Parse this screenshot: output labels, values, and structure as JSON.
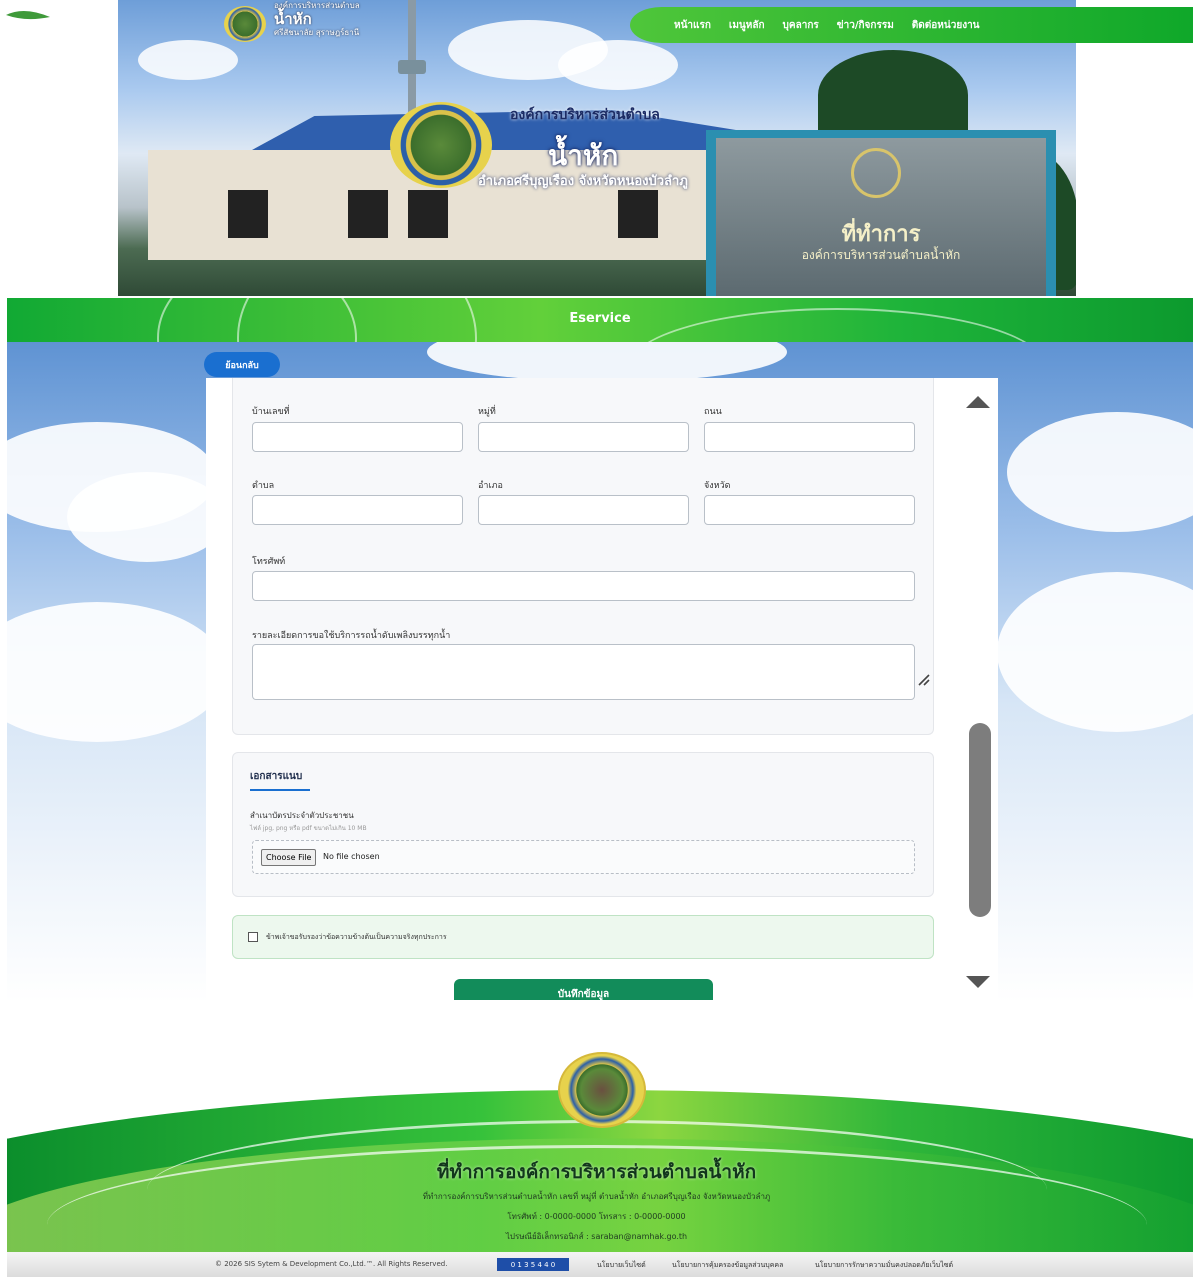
{
  "header": {
    "small_title_line1": "องค์การบริหารส่วนตำบล",
    "small_title_line2": "น้ำหัก",
    "small_title_line3": "ศรีสัชนาลัย สุราษฎร์ธานี",
    "org_line1": "องค์การบริหารส่วนตำบล",
    "org_line2": "น้ำหัก",
    "org_line3": "อำเภอศรีบุญเรือง จังหวัดหนองบัวลำภู",
    "sign_line1": "ที่ทำการ",
    "sign_line2": "องค์การบริหารส่วนตำบลน้ำหัก",
    "nav": [
      "หน้าแรก",
      "เมนูหลัก",
      "บุคลากร",
      "ข่าว/กิจกรรม",
      "ติดต่อหน่วยงาน"
    ]
  },
  "band": {
    "title": "Eservice"
  },
  "back_button": "ย้อนกลับ",
  "form": {
    "labels": {
      "house_no": "บ้านเลขที่",
      "moo": "หมู่ที่",
      "road": "ถนน",
      "subdistrict": "ตำบล",
      "district": "อำเภอ",
      "province": "จังหวัด",
      "phone": "โทรศัพท์",
      "details": "รายละเอียดการขอใช้บริการรถน้ำดับเพลิงบรรทุกน้ำ"
    },
    "values": {
      "house_no": "",
      "moo": "",
      "road": "",
      "subdistrict": "",
      "district": "",
      "province": "",
      "phone": "",
      "details": ""
    }
  },
  "documents": {
    "heading": "เอกสารแนบ",
    "label": "สำเนาบัตรประจำตัวประชาชน",
    "hint": "ไฟล์ jpg, png หรือ pdf ขนาดไม่เกิน 10 MB",
    "choose_label": "Choose File",
    "no_file": "No file chosen"
  },
  "consent": {
    "text": "ข้าพเจ้าขอรับรองว่าข้อความข้างต้นเป็นความจริงทุกประการ",
    "checked": false
  },
  "save_button": "บันทึกข้อมูล",
  "footer": {
    "title": "ที่ทำการองค์การบริหารส่วนตำบลน้ำหัก",
    "line1": "ที่ทำการองค์การบริหารส่วนตำบลน้ำหัก เลขที่ หมู่ที่ ตำบลน้ำหัก อำเภอศรีบุญเรือง จังหวัดหนองบัวลำภู",
    "line2": "โทรศัพท์ : 0-0000-0000 โทรสาร : 0-0000-0000",
    "line3": "ไปรษณีย์อิเล็กทรอนิกส์ : saraban@namhak.go.th",
    "copyright": "© 2026 SIS Sytem & Development Co.,Ltd.™. All Rights Reserved.",
    "counter": "0 1 3 5 4 4 0",
    "links": [
      "นโยบายเว็บไซต์",
      "นโยบายการคุ้มครองข้อมูลส่วนบุคคล",
      "นโยบายการรักษาความมั่นคงปลอดภัยเว็บไซต์"
    ]
  },
  "colors": {
    "primary_green": "#1fb43a",
    "button_blue": "#1a6fd0",
    "save_green": "#128c5a"
  }
}
